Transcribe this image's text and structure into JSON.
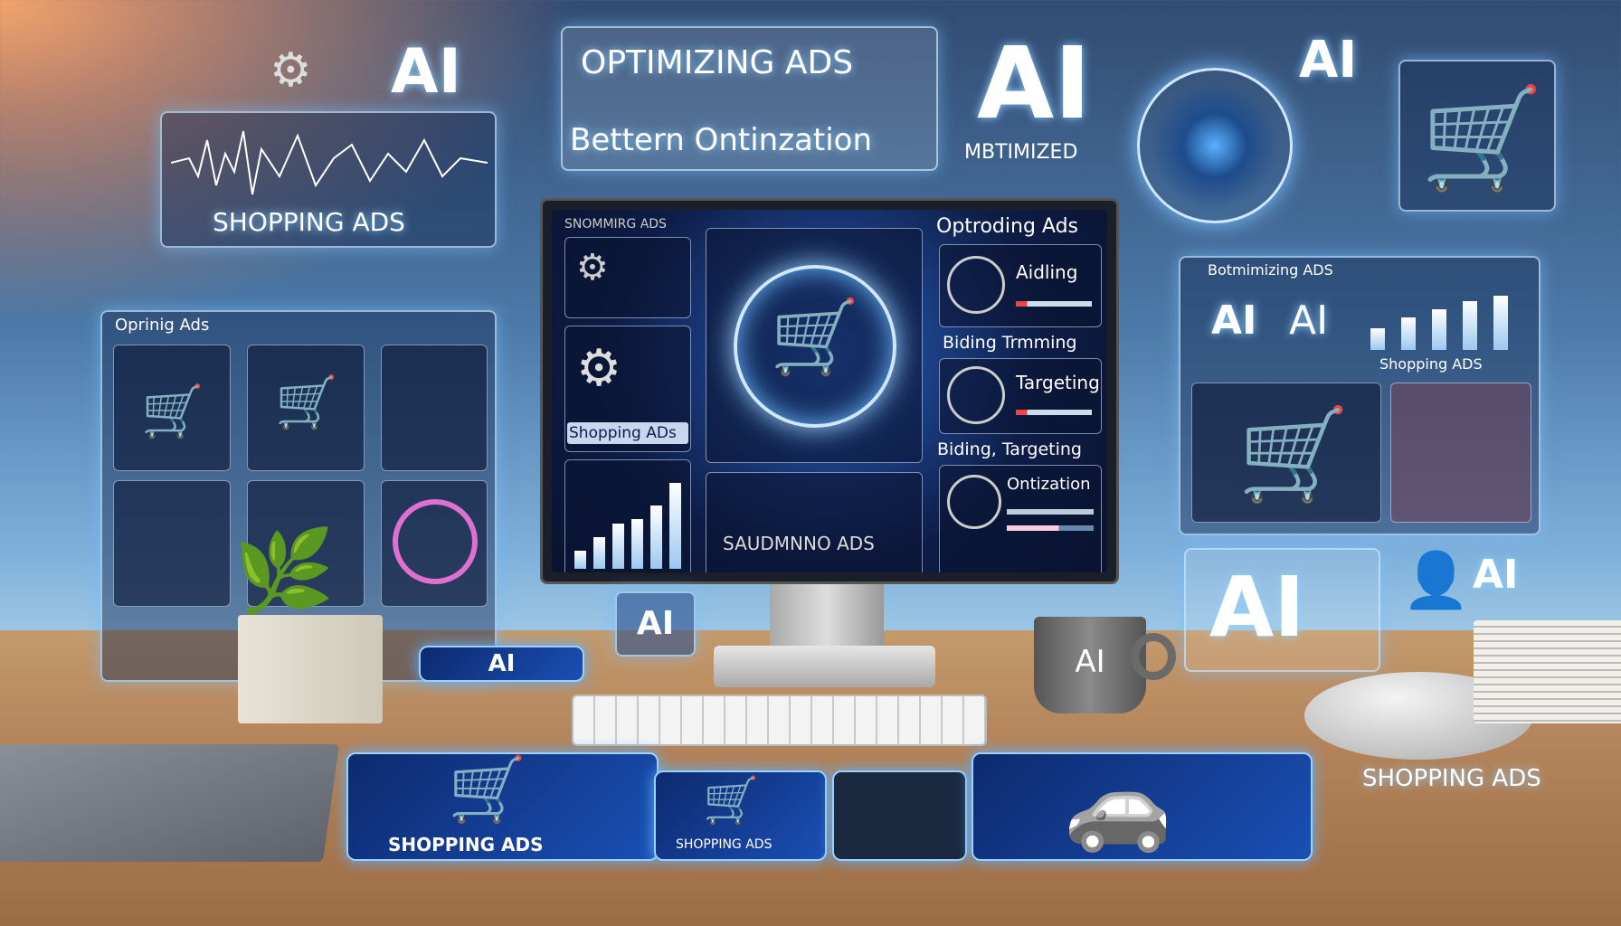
{
  "top_left": {
    "label": "AI",
    "panel_label": "SHOPPING ADS"
  },
  "top_center": {
    "title": "OPTIMIZING ADS",
    "subtitle": "Bettern Ontinzation"
  },
  "big_ai": {
    "label": "AI",
    "sublabel": "MBTIMIZED"
  },
  "top_right_ai": "AI",
  "monitor": {
    "top_left_label": "SNOMMIRG ADS",
    "shopping_label": "Shopping ADs",
    "header": "Optroding Ads",
    "items": [
      {
        "label": "Aidling"
      },
      {
        "label": "Biding Trmming"
      },
      {
        "label": "Targeting"
      },
      {
        "label": "Biding, Targeting"
      },
      {
        "label": "Ontization"
      }
    ],
    "bottom_label": "SAUDMNNO ADS",
    "chart_bars": [
      20,
      35,
      50,
      55,
      70,
      95
    ]
  },
  "left_panel": {
    "title": "Oprinig Ads"
  },
  "right_panel": {
    "title": "Botmimizing ADS",
    "ai_1": "AI",
    "ai_2": "AI",
    "label": "Shopping ADS",
    "bars": [
      40,
      60,
      75,
      90,
      100
    ]
  },
  "bottom_right": {
    "ai_big": "AI",
    "ai_small": "AI"
  },
  "desk": {
    "ai_card": "AI",
    "ai_badge": "AI",
    "mug": "AI",
    "mouse_label": "SHOPPING ADS"
  },
  "cards": [
    {
      "label": "SHOPPING ADS"
    },
    {
      "label": "SHOPPING ADS"
    },
    {
      "label": ""
    },
    {
      "label": ""
    }
  ],
  "colors": {
    "accent": "#5ab0ff",
    "desk": "#b3835a",
    "screen": "#0d1d45"
  },
  "icons": [
    "gear-icon",
    "shopping-cart-icon",
    "car-icon",
    "person-icon",
    "plant"
  ]
}
